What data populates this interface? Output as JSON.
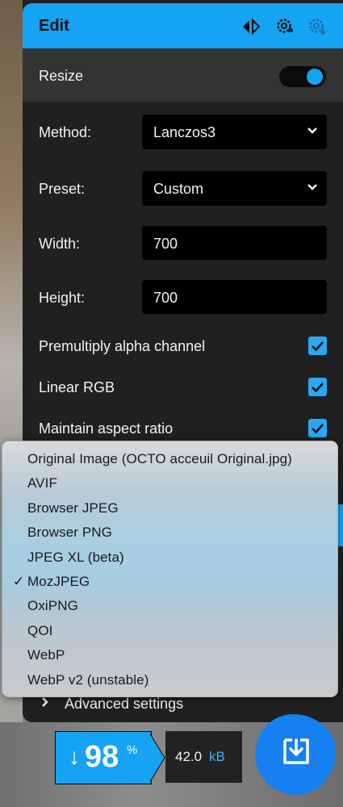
{
  "header": {
    "title": "Edit"
  },
  "resize": {
    "label": "Resize",
    "enabled": true
  },
  "method": {
    "label": "Method:",
    "value": "Lanczos3"
  },
  "preset": {
    "label": "Preset:",
    "value": "Custom"
  },
  "width": {
    "label": "Width:",
    "value": "700"
  },
  "height": {
    "label": "Height:",
    "value": "700"
  },
  "options": [
    {
      "label": "Premultiply alpha channel",
      "checked": true
    },
    {
      "label": "Linear RGB",
      "checked": true
    },
    {
      "label": "Maintain aspect ratio",
      "checked": true
    }
  ],
  "codec_menu": {
    "selected": "MozJPEG",
    "check_mark": "✓",
    "items": [
      "Original Image (OCTO acceuil Original.jpg)",
      "AVIF",
      "Browser JPEG",
      "Browser PNG",
      "JPEG XL (beta)",
      "MozJPEG",
      "OxiPNG",
      "QOI",
      "WebP",
      "WebP v2 (unstable)"
    ]
  },
  "advanced": {
    "label": "Advanced settings"
  },
  "result": {
    "arrow": "↓",
    "percent": "98",
    "percent_sign": "%",
    "size_value": "42.0",
    "size_unit": "kB"
  },
  "colors": {
    "accent": "#15a3f3",
    "download": "#1680f0",
    "panel": "#202020"
  }
}
